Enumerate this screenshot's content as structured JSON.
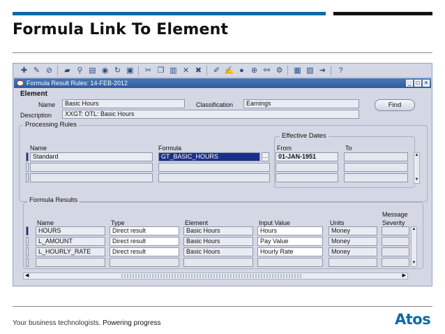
{
  "slide": {
    "title": "Formula Link To Element",
    "footer_tagline": "Your business technologists.",
    "footer_powering": "Powering progress",
    "logo_text": "Atos"
  },
  "window": {
    "title": "Formula Result Rules: 14-FEB-2012"
  },
  "element_section": {
    "heading": "Element",
    "name_label": "Name",
    "name_value": "Basic Hours",
    "classification_label": "Classification",
    "classification_value": "Earnings",
    "description_label": "Description",
    "description_value": "XXGT: OTL: Basic Hours",
    "find_button": "Find"
  },
  "processing_rules": {
    "heading": "Processing Rules",
    "name_header": "Name",
    "formula_header": "Formula",
    "effective_dates_heading": "Effective Dates",
    "from_header": "From",
    "to_header": "To",
    "rows": [
      {
        "name": "Standard",
        "formula": "GT_BASIC_HOURS",
        "from": "01-JAN-1951",
        "to": ""
      },
      {
        "name": "",
        "formula": "",
        "from": "",
        "to": ""
      },
      {
        "name": "",
        "formula": "",
        "from": "",
        "to": ""
      }
    ]
  },
  "formula_results": {
    "heading": "Formula Results",
    "headers": {
      "name": "Name",
      "type": "Type",
      "element": "Element",
      "input_value": "Input Value",
      "units": "Units",
      "message_severity_1": "Message",
      "message_severity_2": "Severity"
    },
    "rows": [
      {
        "name": "HOURS",
        "type": "Direct result",
        "element": "Basic Hours",
        "input_value": "Hours",
        "units": "Money",
        "severity": ""
      },
      {
        "name": "L_AMOUNT",
        "type": "Direct result",
        "element": "Basic Hours",
        "input_value": "Pay Value",
        "units": "Money",
        "severity": ""
      },
      {
        "name": "L_HOURLY_RATE",
        "type": "Direct result",
        "element": "Basic Hours",
        "input_value": "Hourly Rate",
        "units": "Money",
        "severity": ""
      },
      {
        "name": "",
        "type": "",
        "element": "",
        "input_value": "",
        "units": "",
        "severity": ""
      }
    ]
  },
  "toolbar_icons": [
    "new-icon",
    "tools-icon",
    "navigate-icon",
    "open-folder-icon",
    "flashlight-icon",
    "print-icon",
    "save-icon",
    "refresh-icon",
    "cut-icon",
    "copy-icon",
    "paste-icon",
    "clear-record-icon",
    "delete-icon",
    "edit-field-icon",
    "translation-icon",
    "attachment-icon",
    "zoom-icon",
    "calendar-icon",
    "folder-tools-icon",
    "window-icon",
    "help-icon"
  ],
  "colors": {
    "accent_blue": "#0d6aa8",
    "selection": "#1a2f8a",
    "titlebar": "#2f5c9c"
  }
}
